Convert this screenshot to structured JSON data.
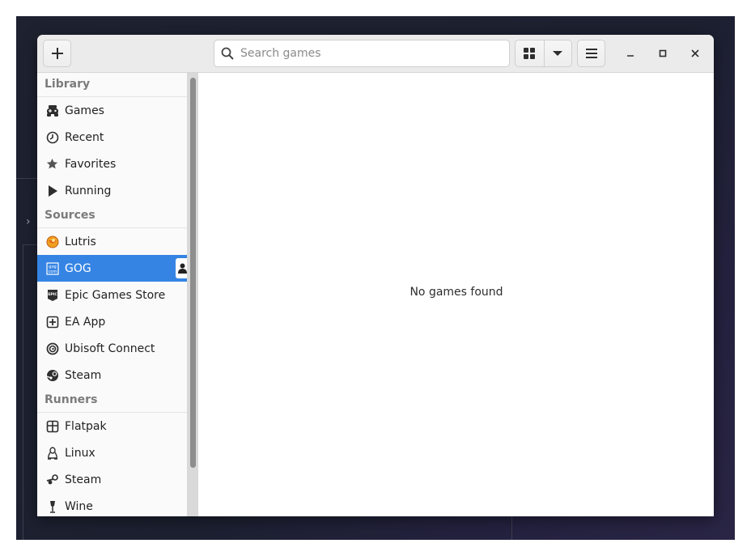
{
  "header": {
    "add_icon": "plus-icon",
    "search": {
      "placeholder": "Search games",
      "value": ""
    },
    "view_icons": [
      "grid-icon",
      "chevron-down-icon"
    ],
    "menu_icon": "hamburger-menu-icon",
    "window_controls": [
      "minimize-icon",
      "maximize-icon",
      "close-icon"
    ]
  },
  "sidebar": {
    "library": {
      "title": "Library",
      "items": [
        {
          "label": "Games",
          "icon": "gamepad-icon"
        },
        {
          "label": "Recent",
          "icon": "clock-icon"
        },
        {
          "label": "Favorites",
          "icon": "star-icon"
        },
        {
          "label": "Running",
          "icon": "play-icon"
        }
      ]
    },
    "sources": {
      "title": "Sources",
      "items": [
        {
          "label": "Lutris",
          "icon": "lutris-icon"
        },
        {
          "label": "GOG",
          "icon": "gog-icon",
          "selected": true
        },
        {
          "label": "Epic Games Store",
          "icon": "epic-icon"
        },
        {
          "label": "EA App",
          "icon": "ea-icon"
        },
        {
          "label": "Ubisoft Connect",
          "icon": "ubisoft-icon"
        },
        {
          "label": "Steam",
          "icon": "steam-icon"
        }
      ]
    },
    "runners": {
      "title": "Runners",
      "items": [
        {
          "label": "Flatpak",
          "icon": "flatpak-icon"
        },
        {
          "label": "Linux",
          "icon": "linux-penguin-icon"
        },
        {
          "label": "Steam",
          "icon": "steam-icon"
        },
        {
          "label": "Wine",
          "icon": "wine-glass-icon"
        }
      ]
    }
  },
  "main": {
    "empty_message": "No games found"
  },
  "colors": {
    "accent": "#3584e4",
    "sidebar_bg": "#fafafa",
    "header_bg": "#ebebeb"
  }
}
